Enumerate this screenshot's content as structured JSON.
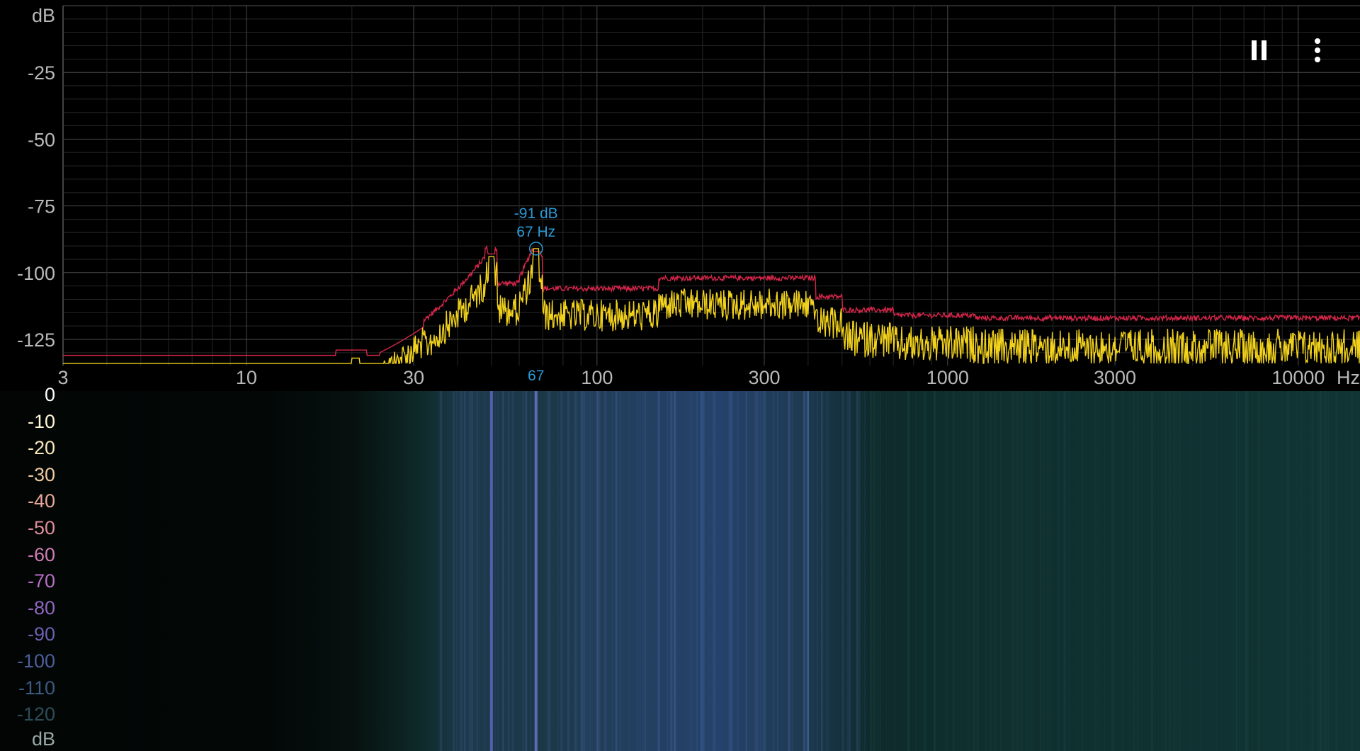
{
  "spectrum": {
    "y_unit": "dB",
    "y_ticks": [
      "-25",
      "-50",
      "-75",
      "-100",
      "-125"
    ],
    "x_unit": "Hz",
    "x_ticks": [
      "3",
      "10",
      "30",
      "100",
      "300",
      "1000",
      "3000",
      "10000"
    ],
    "peak": {
      "db_label": "-91 dB",
      "hz_label": "67 Hz",
      "x_axis_label": "67",
      "hz": 67,
      "db": -91
    },
    "colors": {
      "live_trace": "#f2d21c",
      "peak_hold_trace": "#d4264a",
      "grid": "#3a3a3a",
      "marker": "#2a9ad6"
    }
  },
  "spectrogram": {
    "scale_labels": [
      "0",
      "-10",
      "-20",
      "-30",
      "-40",
      "-50",
      "-60",
      "-70",
      "-80",
      "-90",
      "-100",
      "-110",
      "-120"
    ],
    "scale_colors": [
      "#ffffff",
      "#fff7d6",
      "#f6e8b8",
      "#f0c9a0",
      "#e8a89a",
      "#df8d9c",
      "#cf7db4",
      "#b86fc6",
      "#9066c0",
      "#6a62b0",
      "#4d5e9c",
      "#3d5a80",
      "#2e4c58"
    ],
    "unit": "dB"
  },
  "controls": {
    "pause_icon": "pause-icon",
    "menu_icon": "more-vert-icon"
  }
}
